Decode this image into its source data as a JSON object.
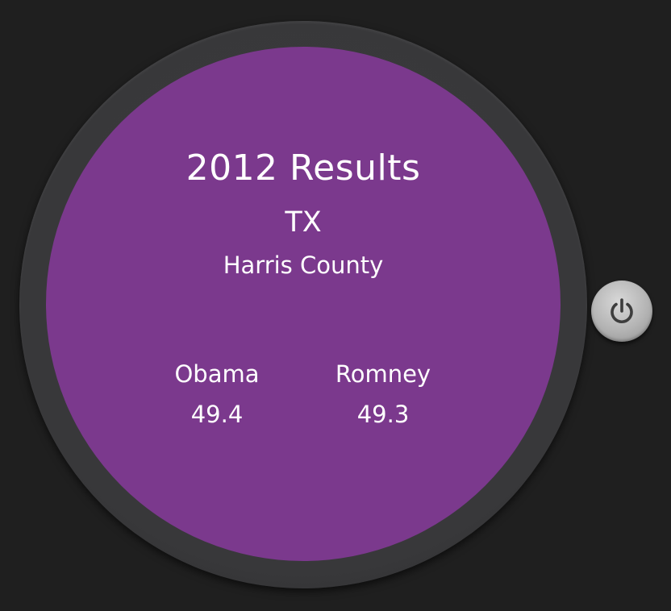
{
  "watch": {
    "title": "2012 Results",
    "state": "TX",
    "county": "Harris County",
    "candidates": [
      {
        "name": "Obama",
        "percent": "49.4"
      },
      {
        "name": "Romney",
        "percent": "49.3"
      }
    ],
    "face_color": "#7b398d"
  },
  "controls": {
    "power_icon": "power-icon"
  }
}
